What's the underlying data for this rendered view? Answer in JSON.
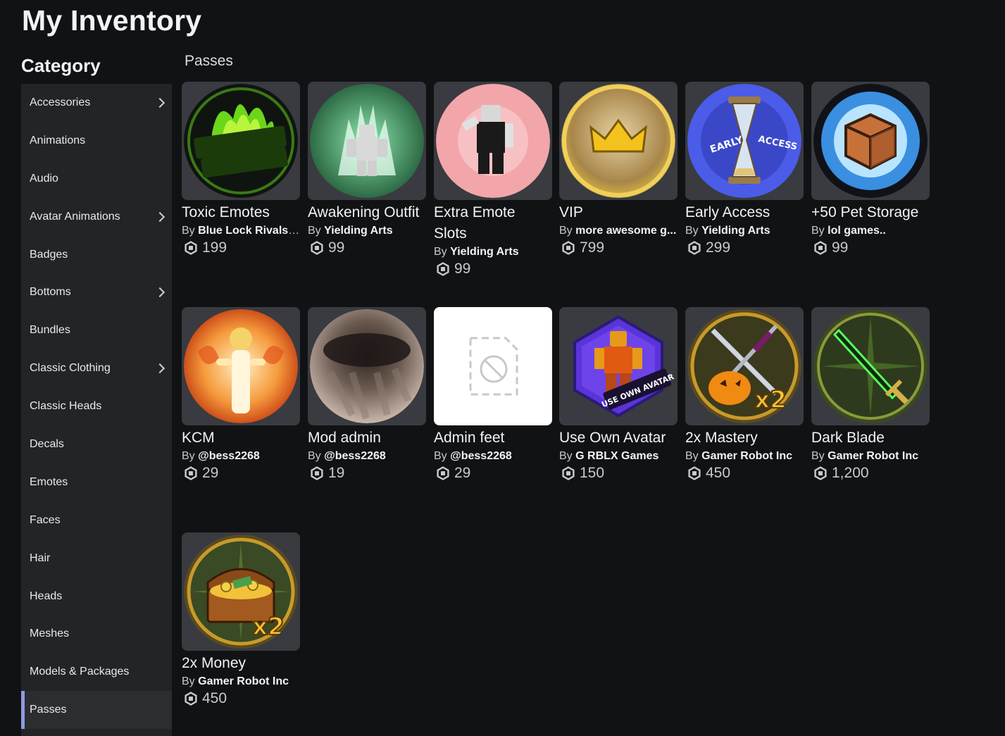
{
  "page": {
    "title": "My Inventory",
    "category_heading": "Category",
    "section_title": "Passes"
  },
  "sidebar": {
    "items": [
      {
        "label": "Accessories",
        "has_submenu": true
      },
      {
        "label": "Animations",
        "has_submenu": false
      },
      {
        "label": "Audio",
        "has_submenu": false
      },
      {
        "label": "Avatar Animations",
        "has_submenu": true
      },
      {
        "label": "Badges",
        "has_submenu": false
      },
      {
        "label": "Bottoms",
        "has_submenu": true
      },
      {
        "label": "Bundles",
        "has_submenu": false
      },
      {
        "label": "Classic Clothing",
        "has_submenu": true
      },
      {
        "label": "Classic Heads",
        "has_submenu": false
      },
      {
        "label": "Decals",
        "has_submenu": false
      },
      {
        "label": "Emotes",
        "has_submenu": false
      },
      {
        "label": "Faces",
        "has_submenu": false
      },
      {
        "label": "Hair",
        "has_submenu": false
      },
      {
        "label": "Heads",
        "has_submenu": false
      },
      {
        "label": "Meshes",
        "has_submenu": false
      },
      {
        "label": "Models & Packages",
        "has_submenu": false
      },
      {
        "label": "Passes",
        "has_submenu": false,
        "active": true
      }
    ]
  },
  "passes": [
    {
      "name": "Toxic Emotes",
      "by": "By",
      "creator": "Blue Lock Rivals ...",
      "price": "199",
      "icon": "toxic-emotes-icon"
    },
    {
      "name": "Awakening Outfit",
      "by": "By",
      "creator": "Yielding Arts",
      "price": "99",
      "icon": "awakening-outfit-icon"
    },
    {
      "name": "Extra Emote Slots",
      "by": "By",
      "creator": "Yielding Arts",
      "price": "99",
      "icon": "extra-emote-slots-icon"
    },
    {
      "name": "VIP",
      "by": "By",
      "creator": "more awesome g...",
      "price": "799",
      "icon": "crown-icon"
    },
    {
      "name": "Early Access",
      "by": "By",
      "creator": "Yielding Arts",
      "price": "299",
      "icon": "hourglass-icon",
      "icon_text_left": "EARLY",
      "icon_text_right": "ACCESS"
    },
    {
      "name": "+50 Pet Storage",
      "by": "By",
      "creator": "lol games..",
      "price": "99",
      "icon": "box-icon"
    },
    {
      "name": "KCM",
      "by": "By",
      "creator": "@bess2268",
      "price": "29",
      "icon": "kcm-icon"
    },
    {
      "name": "Mod admin",
      "by": "By",
      "creator": "@bess2268",
      "price": "19",
      "icon": "mod-admin-icon"
    },
    {
      "name": "Admin feet",
      "by": "By",
      "creator": "@bess2268",
      "price": "29",
      "icon": "image-unavailable-icon"
    },
    {
      "name": "Use Own Avatar",
      "by": "By",
      "creator": "G RBLX Games",
      "price": "150",
      "icon": "use-own-avatar-icon",
      "icon_text": "USE OWN AVATAR"
    },
    {
      "name": "2x Mastery",
      "by": "By",
      "creator": "Gamer Robot Inc",
      "price": "450",
      "icon": "swords-x2-icon",
      "icon_text": "x2"
    },
    {
      "name": "Dark Blade",
      "by": "By",
      "creator": "Gamer Robot Inc",
      "price": "1,200",
      "icon": "dark-blade-icon"
    },
    {
      "name": "2x Money",
      "by": "By",
      "creator": "Gamer Robot Inc",
      "price": "450",
      "icon": "treasure-chest-x2-icon",
      "icon_text": "x2"
    }
  ],
  "colors": {
    "background": "#111214",
    "sidebar": "#232428",
    "card": "#393b40",
    "active_accent": "#8e9ae0"
  }
}
